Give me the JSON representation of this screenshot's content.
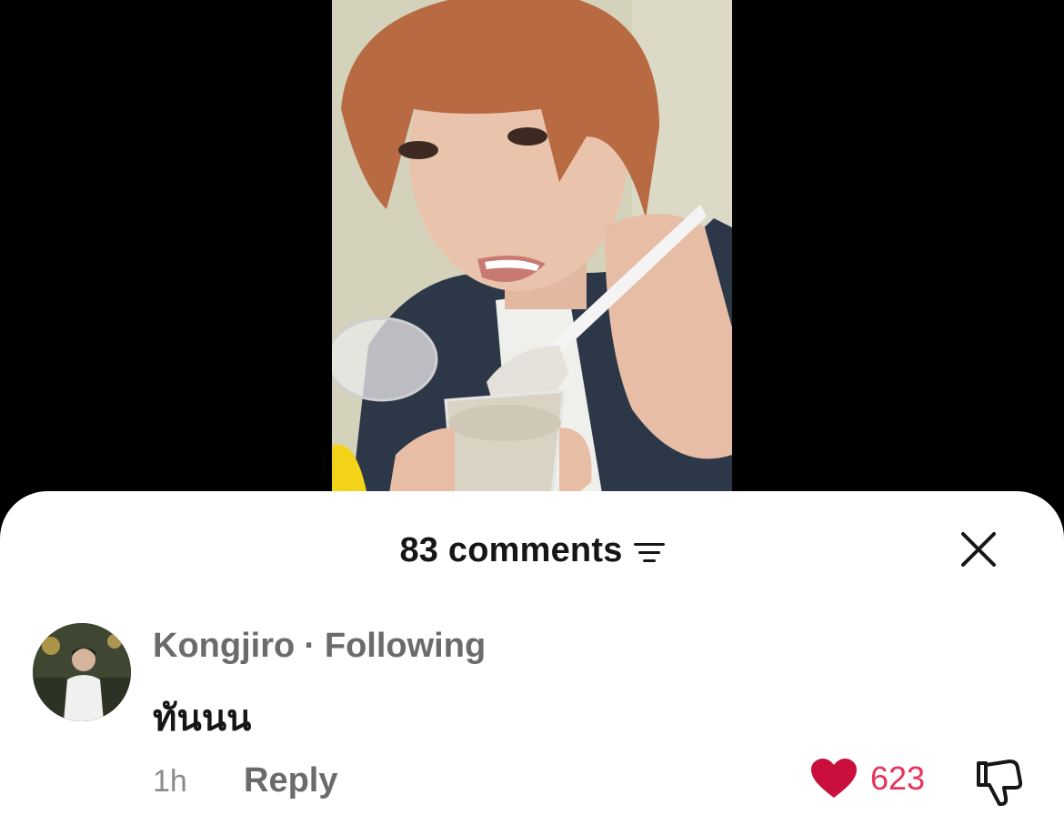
{
  "video": {
    "content": "person eating from a cup with a plastic spoon"
  },
  "sheet": {
    "comments_count": "83 comments"
  },
  "comment": {
    "username": "Kongjiro",
    "separator": "·",
    "relation": "Following",
    "text": "ทันนน",
    "time": "1h",
    "reply_label": "Reply",
    "like_count": "623"
  },
  "colors": {
    "like": "#e6345a",
    "muted": "#6b6b6b",
    "text": "#161616",
    "sheet": "#ffffff",
    "backdrop": "#000000"
  },
  "icons": {
    "sort": "sort-icon",
    "close": "close-icon",
    "like": "heart-icon",
    "dislike": "thumbs-down-icon"
  }
}
